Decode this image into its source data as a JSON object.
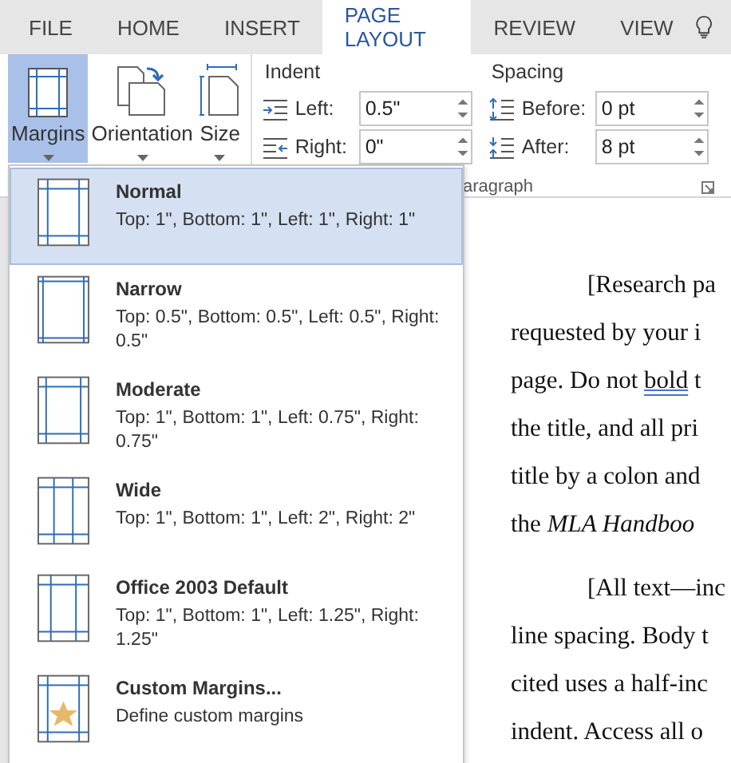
{
  "tabs": [
    {
      "label": "FILE",
      "selected": false
    },
    {
      "label": "HOME",
      "selected": false
    },
    {
      "label": "INSERT",
      "selected": false
    },
    {
      "label": "PAGE LAYOUT",
      "selected": true
    },
    {
      "label": "REVIEW",
      "selected": false
    },
    {
      "label": "VIEW",
      "selected": false
    }
  ],
  "ribbon": {
    "buttons": [
      {
        "label": "Margins",
        "kind": "margins",
        "selected": true
      },
      {
        "label": "Orientation",
        "kind": "orientation",
        "selected": false
      },
      {
        "label": "Size",
        "kind": "size",
        "selected": false
      }
    ],
    "indent": {
      "title": "Indent",
      "fields": [
        {
          "label": "Left:",
          "kind": "indent-left",
          "value": "0.5\""
        },
        {
          "label": "Right:",
          "kind": "indent-right",
          "value": "0\""
        }
      ]
    },
    "spacing": {
      "title": "Spacing",
      "fields": [
        {
          "label": "Before:",
          "kind": "space-before",
          "value": "0 pt"
        },
        {
          "label": "After:",
          "kind": "space-after",
          "value": "8 pt"
        }
      ]
    },
    "group_label": "aragraph"
  },
  "margins_menu": [
    {
      "kind": "normal",
      "title": "Normal",
      "description": "Top: 1\", Bottom: 1\", Left: 1\", Right: 1\"",
      "selected": true
    },
    {
      "kind": "narrow",
      "title": "Narrow",
      "description": "Top: 0.5\", Bottom: 0.5\", Left: 0.5\", Right: 0.5\"",
      "selected": false
    },
    {
      "kind": "moderate",
      "title": "Moderate",
      "description": "Top: 1\", Bottom: 1\", Left: 0.75\", Right: 0.75\"",
      "selected": false
    },
    {
      "kind": "wide",
      "title": "Wide",
      "description": "Top: 1\", Bottom: 1\", Left: 2\", Right: 2\"",
      "selected": false
    },
    {
      "kind": "office",
      "title": "Office 2003 Default",
      "description": "Top: 1\", Bottom: 1\", Left: 1.25\", Right: 1.25\"",
      "selected": false
    },
    {
      "kind": "custom",
      "title": "Custom Margins...",
      "description": "Define custom margins",
      "selected": false
    }
  ],
  "document": {
    "paragraphs": [
      [
        {
          "text": "[Research pa"
        },
        {
          "text": "requested by your i"
        },
        {
          "text": "page.  Do not ",
          "marked": "bold",
          "after": " t"
        },
        {
          "text": "the title, and all pri"
        },
        {
          "text": "title by a colon and"
        },
        {
          "text": "the *MLA Handboo*"
        }
      ],
      [
        {
          "text": "[All text—inc"
        },
        {
          "text": "line spacing. Body t"
        },
        {
          "text": "cited uses a half-inc"
        },
        {
          "text": "indent. Access all o"
        }
      ]
    ]
  }
}
